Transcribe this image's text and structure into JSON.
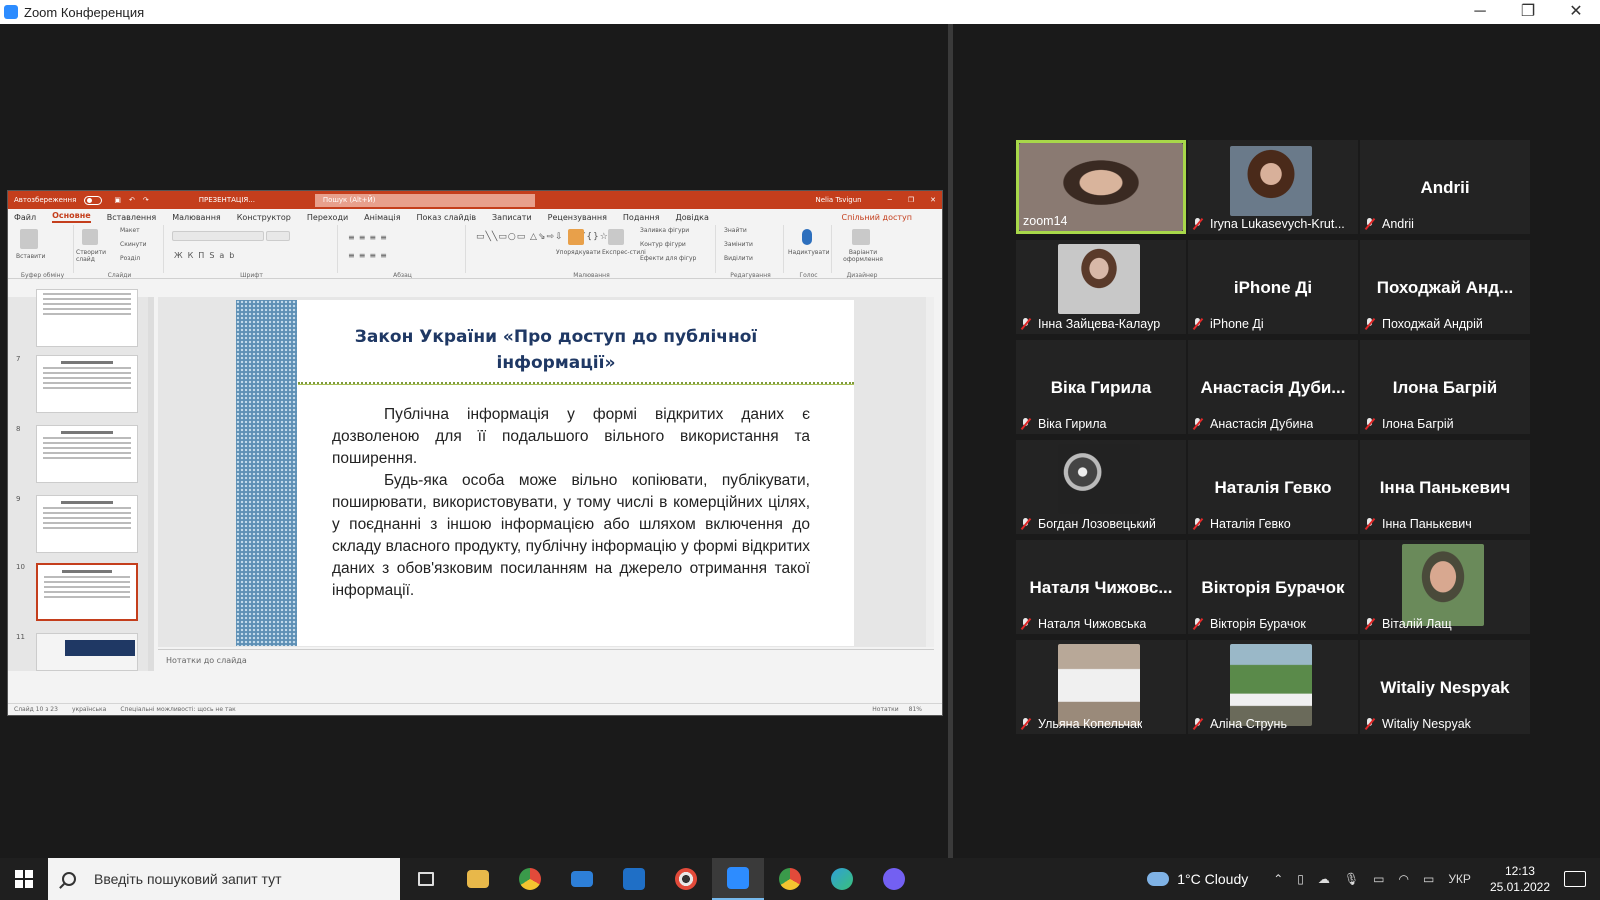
{
  "window": {
    "title": "Zoom Конференция",
    "minimize": "─",
    "restore": "❐",
    "close": "✕"
  },
  "ppt": {
    "autosave": "Автозбереження",
    "filename": "ПРЕЗЕНТАЦІЯ...",
    "search": "Пошук (Alt+Й)",
    "user": "Nelia Tsvigun",
    "tabs": [
      "Файл",
      "Основне",
      "Вставлення",
      "Малювання",
      "Конструктор",
      "Переходи",
      "Анімація",
      "Показ слайдів",
      "Записати",
      "Рецензування",
      "Подання",
      "Довідка"
    ],
    "share": "Спільний доступ",
    "ribbon_groups": [
      "Буфер обміну",
      "Слайди",
      "Шрифт",
      "Абзац",
      "Малювання",
      "Редагування",
      "Голос",
      "Дизайнер"
    ],
    "ribbon_items": {
      "paste": "Вставити",
      "new_slide": "Створити слайд",
      "layout": "Макет",
      "reset": "Скинути",
      "section": "Розділ",
      "arrange": "Упорядкувати",
      "quick_styles": "Експрес-стилі",
      "fill": "Заливка фігури",
      "outline": "Контур фігури",
      "effects": "Ефекти для фігур",
      "find": "Знайти",
      "replace": "Замінити",
      "select": "Виділити",
      "dictate": "Надиктувати",
      "design_ideas": "Варіанти оформлення"
    },
    "thumb_numbers": [
      "7",
      "8",
      "9",
      "10",
      "11"
    ],
    "slide": {
      "title": "Закон України «Про доступ до публічної інформації»",
      "para1": "Публічна інформація у формі відкритих даних є дозволеною для її подальшого вільного використання та поширення.",
      "para2": "Будь-яка особа може вільно копіювати, публікувати, поширювати, використовувати, у тому числі в комерційних цілях, у поєднанні з іншою інформацією або шляхом включення до складу власного продукту, публічну інформацію у формі відкритих даних з обов'язковим посиланням на джерело отримання такої інформації."
    },
    "notes": "Нотатки до слайда",
    "status": {
      "slide": "Слайд 10 з 23",
      "lang": "українська",
      "accessibility": "Спеціальні можливості: щось не так",
      "notes_btn": "Нотатки",
      "zoom": "81%"
    }
  },
  "participants": [
    {
      "name": "zoom14",
      "big": "",
      "photo_color": "#8a6a5a",
      "active": true,
      "muted": false
    },
    {
      "name": "Iryna Lukasevych-Krut...",
      "big": "",
      "photo_color": "#6b4b3b",
      "active": false,
      "muted": true
    },
    {
      "name": "Andrii",
      "big": "Andrii",
      "muted": true
    },
    {
      "name": "Інна Зайцева-Калаур",
      "big": "",
      "photo_color": "#8c8c8c",
      "muted": true
    },
    {
      "name": "iPhone Ді",
      "big": "iPhone Ді",
      "muted": true
    },
    {
      "name": "Походжай Андрій",
      "big": "Походжай Анд...",
      "muted": true
    },
    {
      "name": "Віка Гирила",
      "big": "Віка Гирила",
      "muted": true
    },
    {
      "name": "Анастасія Дубина",
      "big": "Анастасія Дуби...",
      "muted": true
    },
    {
      "name": "Ілона Багрій",
      "big": "Ілона Багрій",
      "muted": true
    },
    {
      "name": "Богдан Лозовецький",
      "big": "",
      "photo_color": "#555555",
      "muted": true
    },
    {
      "name": "Наталія Гевко",
      "big": "Наталія Гевко",
      "muted": true
    },
    {
      "name": "Інна Панькевич",
      "big": "Інна Панькевич",
      "muted": true
    },
    {
      "name": "Наталя Чижовська",
      "big": "Наталя Чижовс...",
      "muted": true
    },
    {
      "name": "Вікторія Бурачок",
      "big": "Вікторія Бурачок",
      "muted": true
    },
    {
      "name": "Віталій Лащ",
      "big": "",
      "photo_color": "#6a7a5a",
      "muted": true
    },
    {
      "name": "Ульяна Копельчак",
      "big": "",
      "photo_color": "#9a8a7a",
      "muted": true
    },
    {
      "name": "Аліна Струнь",
      "big": "",
      "photo_color": "#5a7a4a",
      "muted": true
    },
    {
      "name": "Witaliy Nespyak",
      "big": "Witaliy Nespyak",
      "muted": true
    }
  ],
  "taskbar": {
    "search_placeholder": "Введіть пошуковий запит тут",
    "weather": "1°C  Cloudy",
    "lang": "УКР",
    "time": "12:13",
    "date": "25.01.2022",
    "app_colors": [
      "#dcdcdc",
      "#e8b84a",
      "#e24a3a",
      "#2d7fd8",
      "#1f6fc6",
      "#e8e8e8",
      "#2d8cff",
      "#3a9a4a",
      "#2f9fd8",
      "#7360f2"
    ]
  }
}
